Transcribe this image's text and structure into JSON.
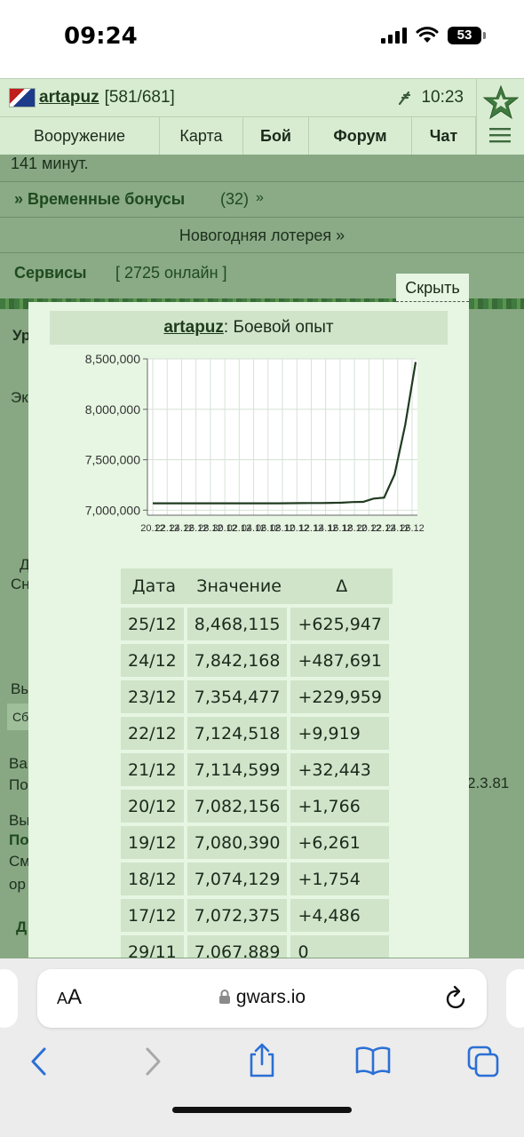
{
  "status_bar": {
    "time": "09:24",
    "battery": "53"
  },
  "header": {
    "nickname": "artapuz",
    "level": "[581/681]",
    "clock": "10:23",
    "nav": [
      "Вооружение",
      "Карта",
      "Бой",
      "Форум",
      "Чат"
    ]
  },
  "background": {
    "minutes_text": "141 минут.",
    "bonuses_title": "» Временные бонусы",
    "bonuses_count": "(32)",
    "lottery": "Новогодняя лотерея »",
    "services_title": "Сервисы",
    "online": "[ 2725 онлайн ]",
    "stub_texts": [
      "Ур",
      "Эк",
      "Д",
      "Сн",
      "Вы",
      "Сб",
      "Ва",
      "По",
      "Вы",
      "По",
      "См",
      "ор",
      "Д",
      "2.3.81"
    ]
  },
  "hide_link": "Скрыть",
  "popup": {
    "player": "artapuz",
    "title_suffix": ": Боевой опыт",
    "table": {
      "headers": [
        "Дата",
        "Значение",
        "Δ"
      ],
      "rows": [
        [
          "25/12",
          "8,468,115",
          "+625,947"
        ],
        [
          "24/12",
          "7,842,168",
          "+487,691"
        ],
        [
          "23/12",
          "7,354,477",
          "+229,959"
        ],
        [
          "22/12",
          "7,124,518",
          "+9,919"
        ],
        [
          "21/12",
          "7,114,599",
          "+32,443"
        ],
        [
          "20/12",
          "7,082,156",
          "+1,766"
        ],
        [
          "19/12",
          "7,080,390",
          "+6,261"
        ],
        [
          "18/12",
          "7,074,129",
          "+1,754"
        ],
        [
          "17/12",
          "7,072,375",
          "+4,486"
        ],
        [
          "29/11",
          "7,067,889",
          "0"
        ]
      ]
    }
  },
  "chart_data": {
    "type": "line",
    "title": "",
    "xlabel": "",
    "ylabel": "",
    "ylim": [
      6950000,
      8500000
    ],
    "y_ticks": [
      "8,500,000",
      "8,000,000",
      "7,500,000",
      "7,000,000"
    ],
    "y_tick_values": [
      8500000,
      8000000,
      7500000,
      7000000
    ],
    "x_ticks": [
      "20.12",
      "22.12",
      "24.12",
      "26.12",
      "28.12",
      "30.12",
      "02.12",
      "04.12",
      "06.12",
      "08.12",
      "10.12",
      "12.12",
      "14.12",
      "16.12",
      "18.12",
      "20.12",
      "22.12",
      "24.12",
      "26.12"
    ],
    "values": [
      7067889,
      7067889,
      7067889,
      7067889,
      7067889,
      7067889,
      7067889,
      7067889,
      7067889,
      7067889,
      7067889,
      7067889,
      7067889,
      7068500,
      7069500,
      7070500,
      7071000,
      7072375,
      7074129,
      7080390,
      7082156,
      7114599,
      7124518,
      7354477,
      7842168,
      8468115
    ],
    "grid": true,
    "line_color": "#1f3a1f"
  },
  "safari": {
    "url": "gwars.io",
    "aa": "AA"
  }
}
